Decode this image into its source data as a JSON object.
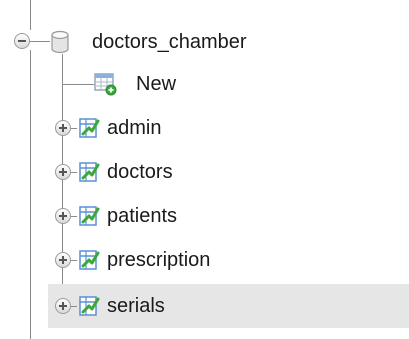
{
  "tree": {
    "database": {
      "name": "doctors_chamber",
      "icon": "database-icon"
    },
    "new_item": {
      "label": "New",
      "icon": "new-table-icon"
    },
    "tables": [
      {
        "label": "admin",
        "icon": "table-icon"
      },
      {
        "label": "doctors",
        "icon": "table-icon"
      },
      {
        "label": "patients",
        "icon": "table-icon"
      },
      {
        "label": "prescription",
        "icon": "table-icon"
      },
      {
        "label": "serials",
        "icon": "table-icon",
        "hovered": true
      }
    ]
  },
  "colors": {
    "hover_row_bg": "#e6e6e6",
    "connector_line": "#8a8a8a",
    "table_icon_green": "#3aa83a",
    "table_icon_blue": "#5b8fd6"
  }
}
